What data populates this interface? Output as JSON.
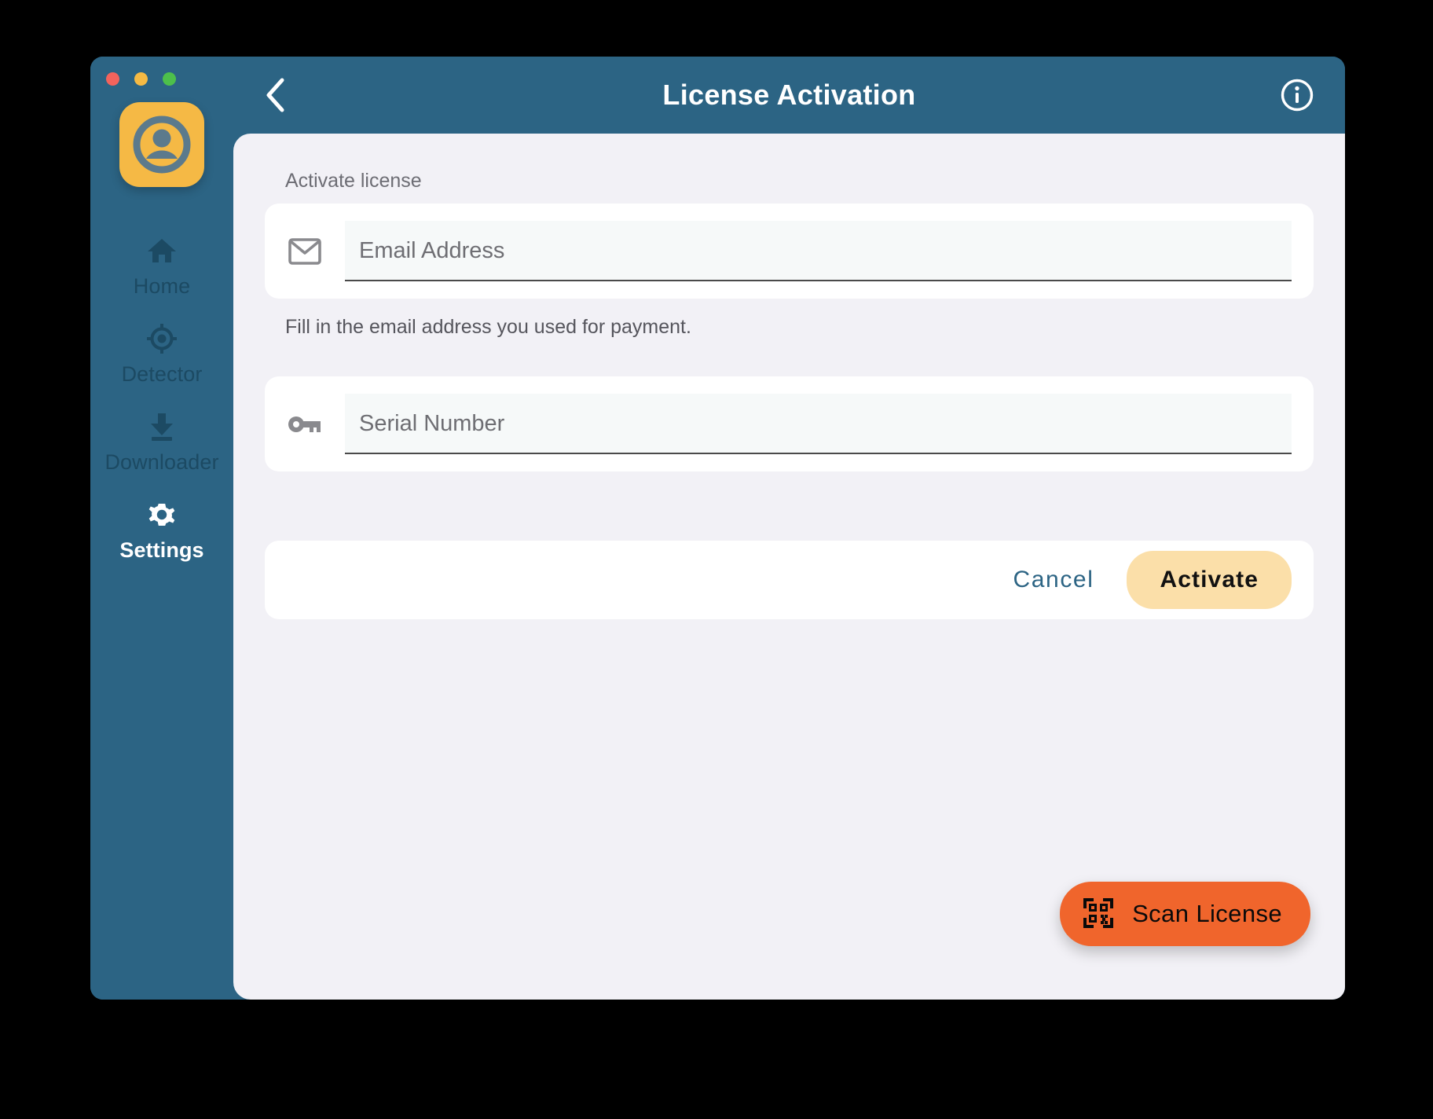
{
  "window": {
    "traffic_lights": [
      {
        "name": "close",
        "color": "#F3635C"
      },
      {
        "name": "minimize",
        "color": "#F5BA44"
      },
      {
        "name": "zoom",
        "color": "#4DBF4B"
      }
    ],
    "chrome_color": "#2C6484"
  },
  "sidebar": {
    "avatar_icon": "user-avatar-icon",
    "avatar_bg": "#F5B945",
    "items": [
      {
        "label": "Home",
        "icon": "home-icon",
        "active": false
      },
      {
        "label": "Detector",
        "icon": "crosshair-icon",
        "active": false
      },
      {
        "label": "Downloader",
        "icon": "download-icon",
        "active": false
      },
      {
        "label": "Settings",
        "icon": "gear-icon",
        "active": true
      }
    ]
  },
  "header": {
    "back_icon": "chevron-left-icon",
    "title": "License Activation",
    "info_icon": "info-circle-icon"
  },
  "main": {
    "section_label": "Activate license",
    "email_field": {
      "icon": "envelope-icon",
      "placeholder": "Email Address",
      "value": ""
    },
    "helper_text": "Fill in the email address you used for payment.",
    "serial_field": {
      "icon": "key-icon",
      "placeholder": "Serial Number",
      "value": ""
    },
    "actions": {
      "cancel_label": "Cancel",
      "activate_label": "Activate",
      "activate_bg": "#FBDFA9"
    },
    "scan_button": {
      "label": "Scan License",
      "icon": "qr-code-icon",
      "bg": "#F0652C"
    }
  }
}
